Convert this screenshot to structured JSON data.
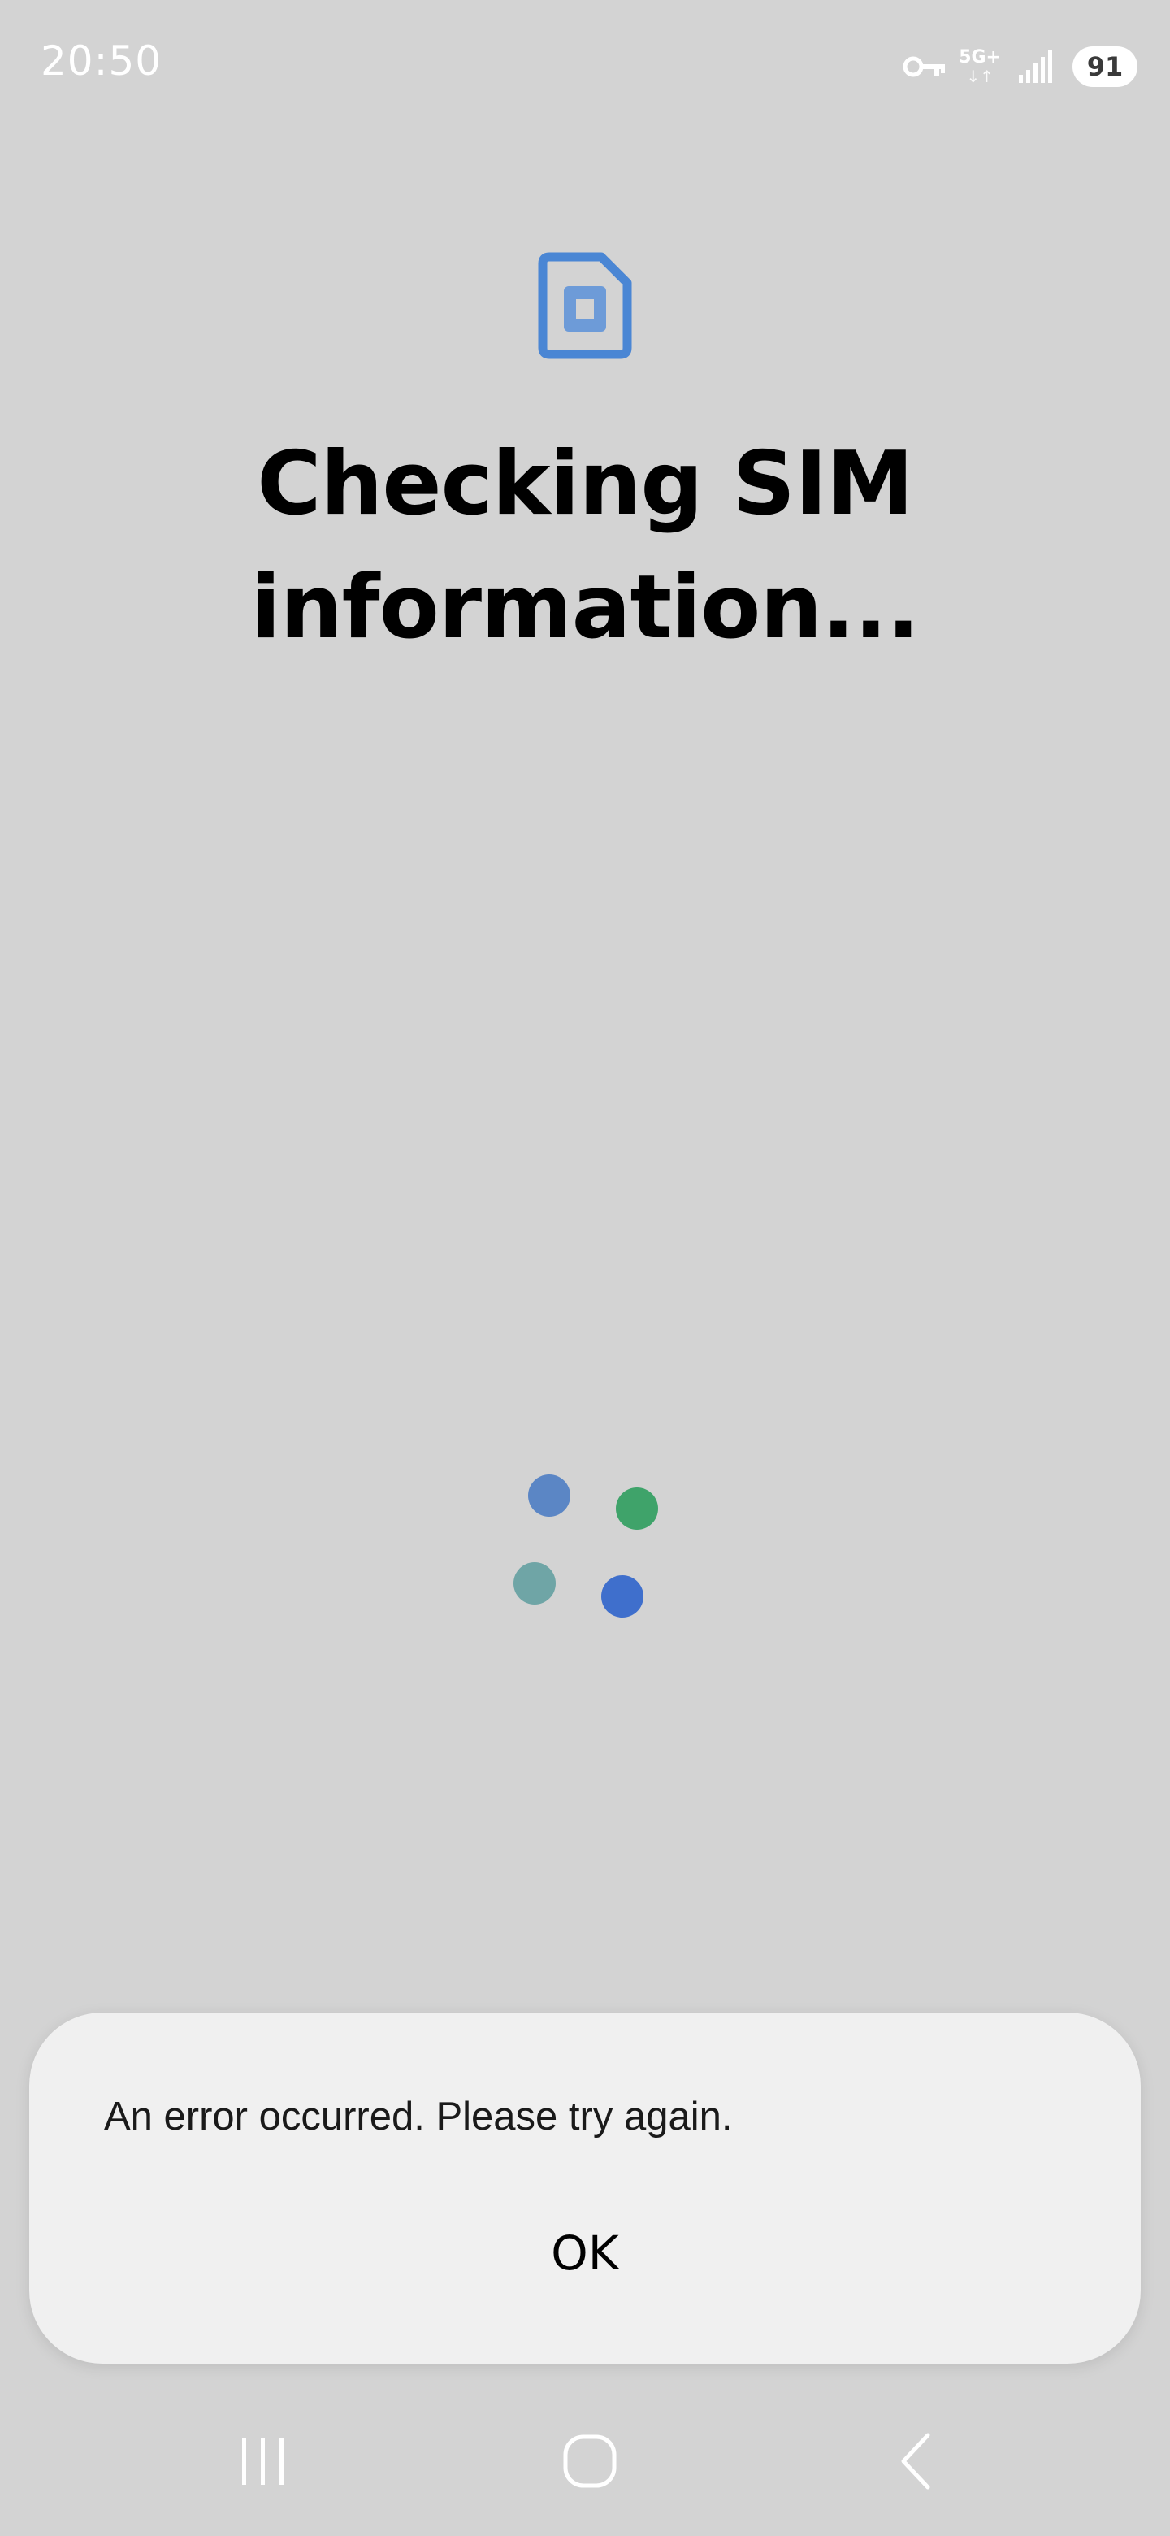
{
  "status_bar": {
    "time": "20:50",
    "network_type": "5G+",
    "network_arrows": "↓↑",
    "battery": "91",
    "icons": [
      "vpn-key-icon",
      "signal-icon",
      "battery-icon"
    ]
  },
  "main": {
    "icon": "sim-card-icon",
    "title_line1": "Checking SIM",
    "title_line2": "information...",
    "spinner_colors": [
      "#5b86c5",
      "#3fa36a",
      "#6fa5a6",
      "#3f6fcc"
    ]
  },
  "dialog": {
    "message": "An error occurred. Please try again.",
    "ok_label": "OK"
  },
  "nav_bar": {
    "icons": [
      "recent-apps-icon",
      "home-icon",
      "back-icon"
    ]
  },
  "colors": {
    "background": "#d3d3d3",
    "accent": "#4a86d4",
    "dialog_background": "#f0f0f0"
  }
}
